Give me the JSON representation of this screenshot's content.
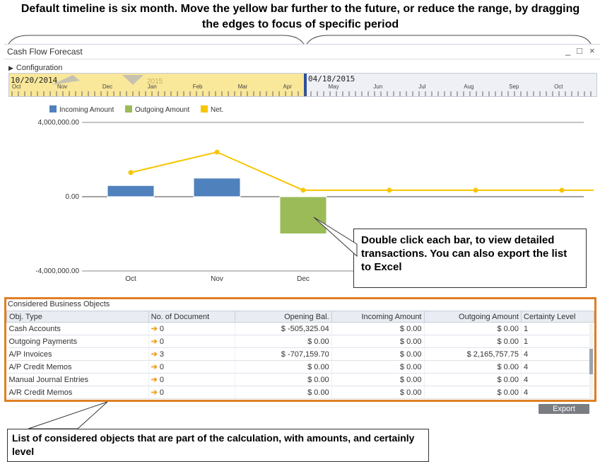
{
  "annotations": {
    "top": "Default timeline is six month. Move the yellow bar further to the future, or reduce the range, by dragging the edges to focus of specific period",
    "chart": "Double click each bar, to view detailed transactions. You can also export the list to Excel",
    "bottom": "List of considered objects that are part of the calculation, with amounts, and certainly level"
  },
  "window": {
    "title": "Cash Flow Forecast",
    "minimize": "_",
    "maximize": "□",
    "close": "×"
  },
  "config": {
    "label": "Configuration"
  },
  "timeline": {
    "start_date": "10/20/2014",
    "end_date": "04/18/2015",
    "year": "2015",
    "months": [
      "Oct",
      "Nov",
      "Dec",
      "Jan",
      "Feb",
      "Mar",
      "Apr",
      "May",
      "Jun",
      "Jul",
      "Aug",
      "Sep",
      "Oct"
    ],
    "selection_color": "#f9e79a"
  },
  "chart_data": {
    "type": "bar",
    "categories": [
      "Oct",
      "Nov",
      "Dec"
    ],
    "series": [
      {
        "name": "Incoming Amount",
        "kind": "bar",
        "color": "#4f81bd",
        "values": [
          600000,
          1000000,
          0
        ]
      },
      {
        "name": "Outgoing Amount",
        "kind": "bar",
        "color": "#9bbb59",
        "values": [
          0,
          0,
          -2000000
        ]
      },
      {
        "name": "Net.",
        "kind": "line",
        "color": "#f7c600",
        "x": [
          0,
          1,
          2,
          3,
          4,
          5,
          6
        ],
        "values": [
          1300000,
          2400000,
          350000,
          350000,
          350000,
          350000,
          350000
        ]
      }
    ],
    "y_ticks": [
      "4,000,000.00",
      "0.00",
      "-4,000,000.00"
    ],
    "y_tick_values": [
      4000000,
      0,
      -4000000
    ],
    "ylim": [
      -4000000,
      4000000
    ],
    "legend": "top-left",
    "grid": false
  },
  "objects": {
    "title": "Considered Business Objects",
    "columns": [
      "Obj. Type",
      "No. of Document",
      "Opening Bal.",
      "Incoming Amount",
      "Outgoing Amount",
      "Certainty Level"
    ],
    "rows": [
      [
        "Cash Accounts",
        "0",
        "$ -505,325.04",
        "$ 0.00",
        "$ 0.00",
        "1"
      ],
      [
        "Outgoing Payments",
        "0",
        "$ 0.00",
        "$ 0.00",
        "$ 0.00",
        "1"
      ],
      [
        "A/P Invoices",
        "3",
        "$ -707,159.70",
        "$ 0.00",
        "$ 2,165,757.75",
        "4"
      ],
      [
        "A/P Credit Memos",
        "0",
        "$ 0.00",
        "$ 0.00",
        "$ 0.00",
        "4"
      ],
      [
        "Manual Journal Entries",
        "0",
        "$ 0.00",
        "$ 0.00",
        "$ 0.00",
        "4"
      ],
      [
        "A/R Credit Memos",
        "0",
        "$ 0.00",
        "$ 0.00",
        "$ 0.00",
        "4"
      ]
    ]
  },
  "export": {
    "label": "Export"
  }
}
